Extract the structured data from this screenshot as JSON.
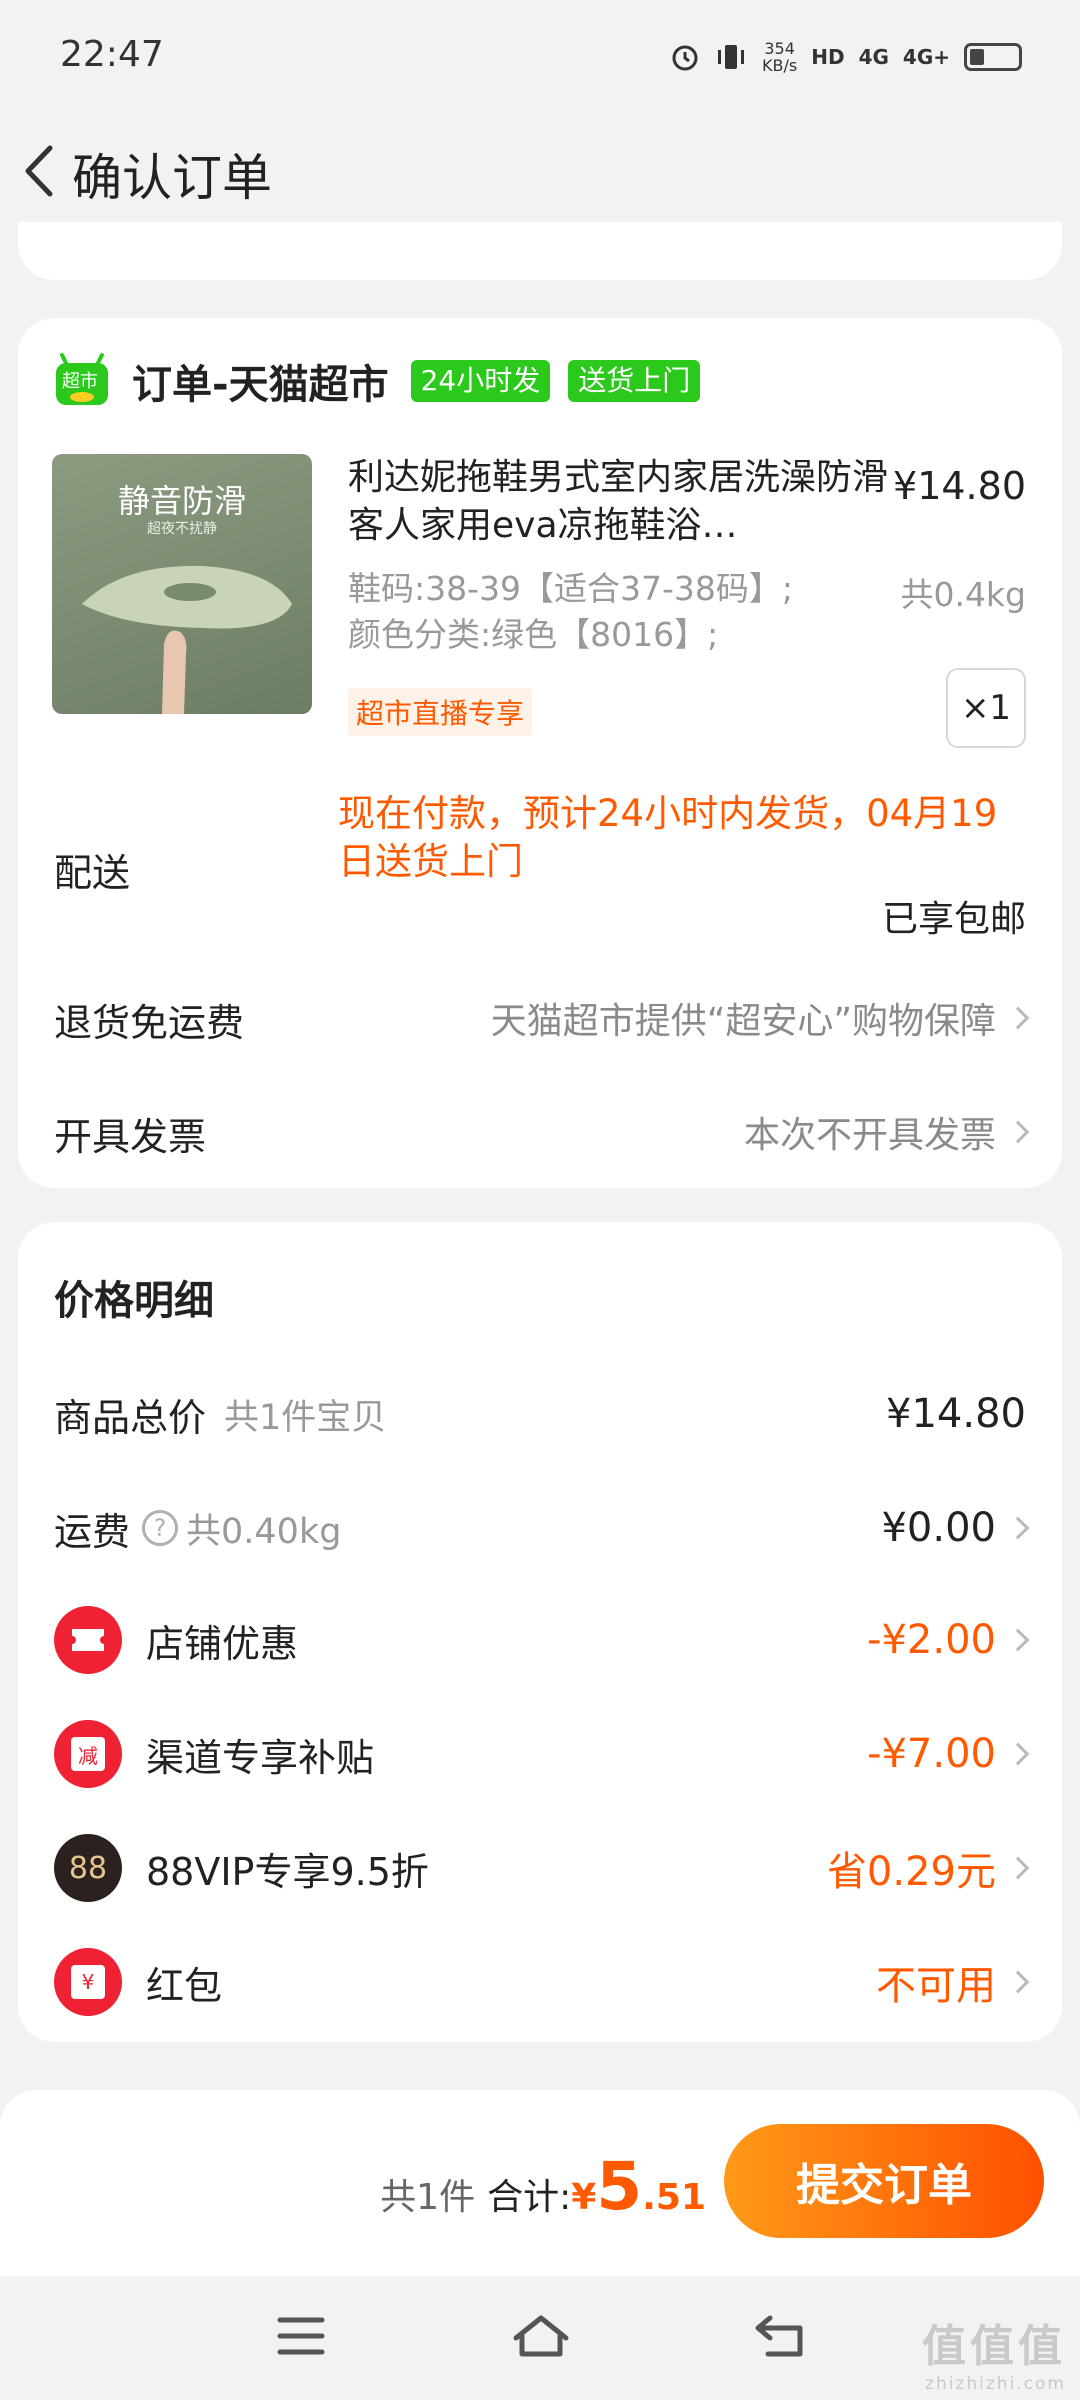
{
  "status_bar": {
    "time": "22:47",
    "net_speed": "354",
    "net_unit": "KB/s",
    "hd": "HD",
    "sig1": "4G",
    "sig2": "4G+"
  },
  "header": {
    "title": "确认订单"
  },
  "order": {
    "store_logo_text": "超市",
    "store_name": "订单-天猫超市",
    "tags": [
      "24小时发",
      "送货上门"
    ],
    "product": {
      "image_title": "静音防滑",
      "image_subtitle": "超夜不扰静",
      "title": "利达妮拖鞋男式室内家居洗澡防滑客人家用eva凉拖鞋浴…",
      "price": "¥14.80",
      "spec_line1": "鞋码:38-39【适合37-38码】;",
      "spec_line2": "颜色分类:绿色【8016】;",
      "weight": "共0.4kg",
      "promo_tag": "超市直播专享",
      "quantity": "×1"
    },
    "delivery": {
      "label": "配送",
      "note": "现在付款，预计24小时内发货，04月19日送货上门",
      "free_shipping": "已享包邮"
    },
    "return": {
      "label": "退货免运费",
      "value": "天猫超市提供“超安心”购物保障"
    },
    "invoice": {
      "label": "开具发票",
      "value": "本次不开具发票"
    }
  },
  "price_detail": {
    "title": "价格明细",
    "goods_total": {
      "label": "商品总价",
      "sub": "共1件宝贝",
      "value": "¥14.80"
    },
    "shipping": {
      "label": "运费",
      "help": "?",
      "sub": "共0.40kg",
      "value": "¥0.00"
    },
    "store_discount": {
      "label": "店铺优惠",
      "value": "-¥2.00"
    },
    "channel_subsidy": {
      "label": "渠道专享补贴",
      "icon_text": "减",
      "value": "-¥7.00"
    },
    "vip": {
      "label": "88VIP专享9.5折",
      "icon_text": "88",
      "value": "省0.29元"
    },
    "red_packet": {
      "label": "红包",
      "icon_text": "¥",
      "value": "不可用"
    }
  },
  "bottom_bar": {
    "count": "共1件",
    "total_label": "合计:",
    "currency": "¥",
    "total_int": "5",
    "total_dec": ".51",
    "submit": "提交订单"
  },
  "watermark": {
    "main": "值值值",
    "sub": "zhizhizhi.com"
  },
  "icons": [
    "back-icon",
    "alarm-icon",
    "vibrate-icon",
    "hd-icon",
    "signal-icon",
    "battery-icon",
    "chevron-right-icon",
    "help-icon",
    "coupon-icon",
    "subsidy-icon",
    "vip-icon",
    "red-packet-icon",
    "menu-icon",
    "home-icon",
    "return-icon"
  ],
  "colors": {
    "accent": "#ff5a00",
    "tag_green": "#2bc91c",
    "icon_red": "#ee2233",
    "background": "#f2f2f2"
  }
}
